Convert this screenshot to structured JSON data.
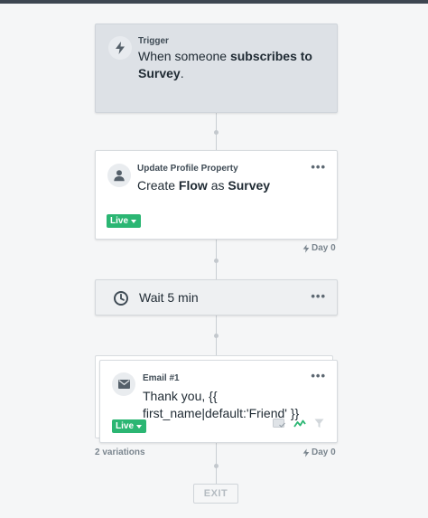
{
  "trigger": {
    "kicker": "Trigger",
    "text_prefix": "When someone ",
    "text_bold1": "subscribes to",
    "text_bold2": "Survey",
    "text_suffix": "."
  },
  "update_profile": {
    "kicker": "Update Profile Property",
    "text_prefix": "Create ",
    "text_bold1": "Flow",
    "text_mid": " as ",
    "text_bold2": "Survey",
    "status": "Live",
    "delay": "Day 0"
  },
  "wait": {
    "text": "Wait 5 min"
  },
  "email": {
    "kicker": "Email #1",
    "text": "Thank you, {{ first_name|default:'Friend' }}",
    "status": "Live",
    "variations": "2 variations",
    "delay": "Day 0"
  },
  "exit": {
    "label": "EXIT"
  },
  "icons": {
    "trigger": "lightning-icon",
    "update": "person-icon",
    "wait": "clock-icon",
    "email": "envelope-icon"
  }
}
